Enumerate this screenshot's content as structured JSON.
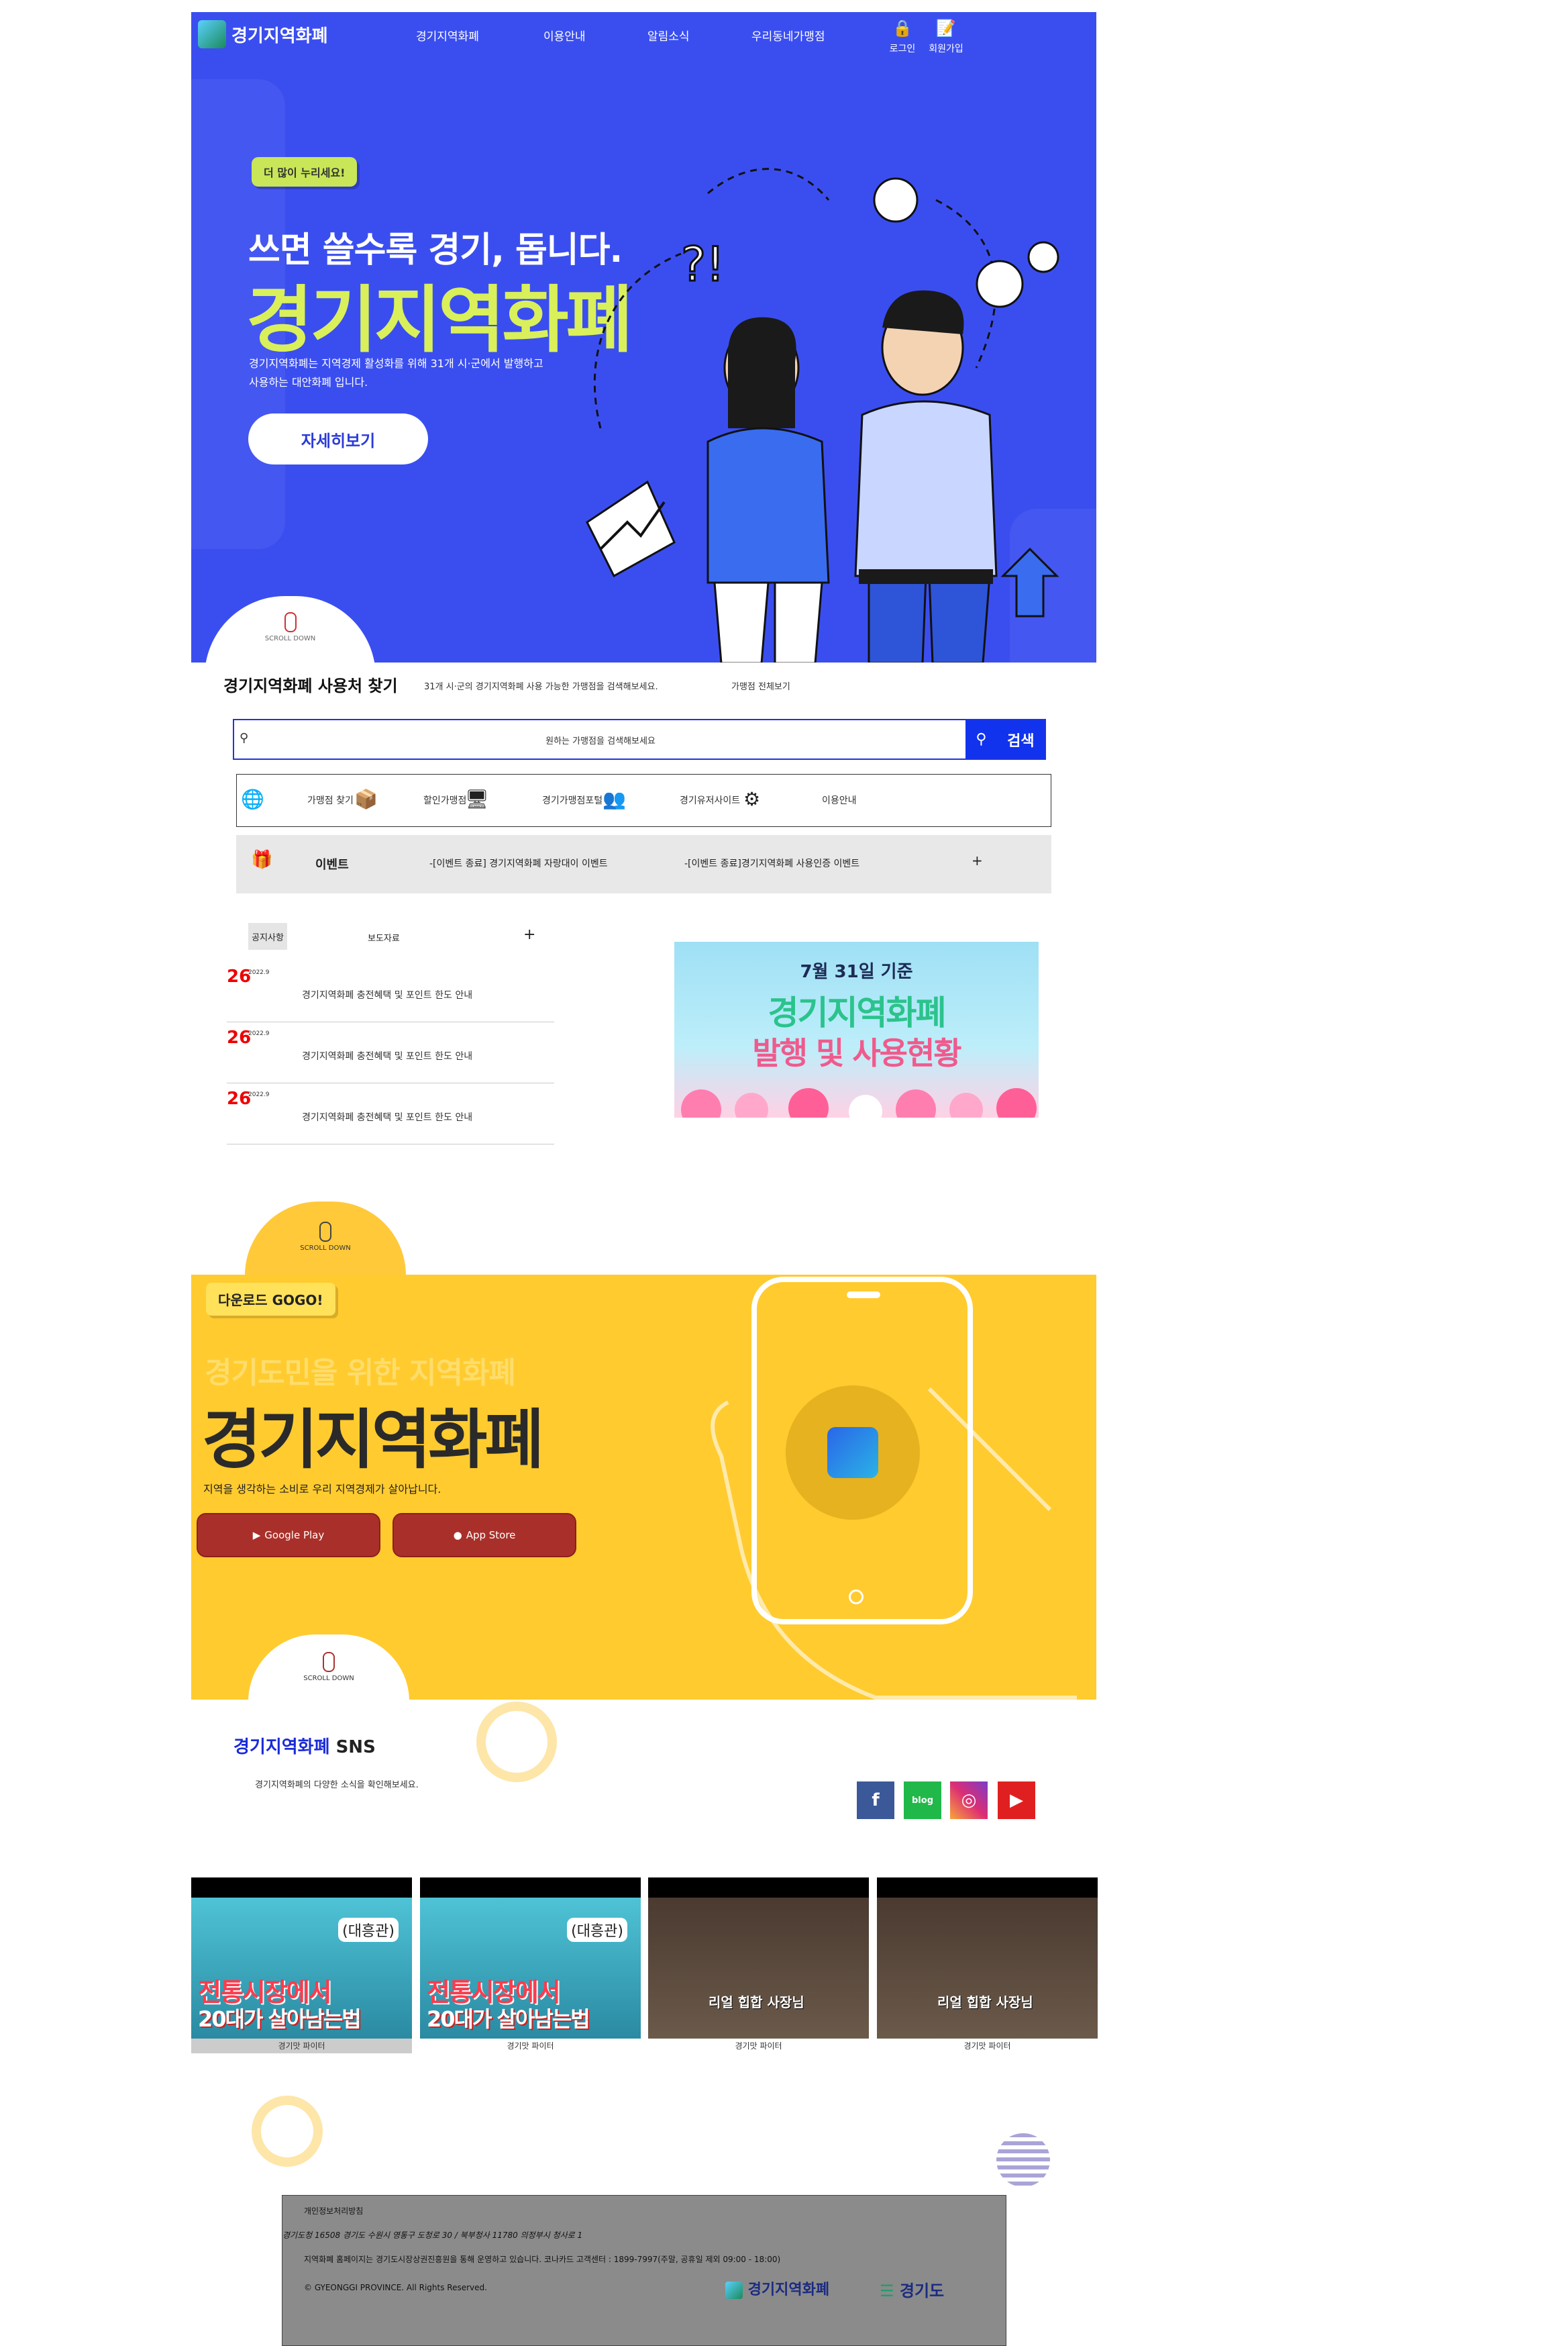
{
  "nav": {
    "logo": "경기지역화폐",
    "items": [
      "경기지역화폐",
      "이용안내",
      "알림소식",
      "우리동네가맹점"
    ],
    "login": "로그인",
    "signup": "회원가입"
  },
  "hero": {
    "bubble": "더 많이 누리세요!",
    "subtitle": "쓰면 쓸수록 경기, 돕니다.",
    "title": "경기지역화폐",
    "description": "경기지역화폐는 지역경제 활성화를 위해 31개 시·군에서 발행하고 사용하는 대안화폐 입니다.",
    "button": "자세히보기",
    "scroll": "SCROLL DOWN"
  },
  "find": {
    "title": "경기지역화폐 사용처 찾기",
    "description": "31개 시·군의 경기지역화폐 사용 가능한 가맹점을 검색해보세요.",
    "all_link": "가맹점 전체보기",
    "search_placeholder": "원하는 가맹점을 검색해보세요",
    "search_button": "검색"
  },
  "quick_menu": [
    "가맹점 찾기",
    "할인가맹점",
    "경기가맹점포털",
    "경기유저사이트",
    "이용안내"
  ],
  "event": {
    "label": "이벤트",
    "items": [
      "-[이벤트 종료] 경기지역화폐 자랑대이 이벤트",
      "-[이벤트 종료]경기지역화폐 사용인증 이벤트"
    ],
    "more": "+"
  },
  "notice_tabs": {
    "notice": "공지사항",
    "press": "보도자료",
    "more": "+"
  },
  "notices": [
    {
      "day": "26",
      "ym": "2022.9",
      "text": "경기지역화폐 충전혜택 및 포인트 한도 안내"
    },
    {
      "day": "26",
      "ym": "2022.9",
      "text": "경기지역화폐 충전혜택 및 포인트 한도 안내"
    },
    {
      "day": "26",
      "ym": "2022.9",
      "text": "경기지역화폐 충전혜택 및 포인트 한도 안내"
    }
  ],
  "banner": {
    "line1": "7월 31일 기준",
    "line2": "경기지역화폐",
    "line3": "발행 및 사용현황"
  },
  "app": {
    "bubble": "다운로드 GOGO!",
    "subtitle": "경기도민을 위한 지역화폐",
    "title": "경기지역화폐",
    "description": "지역을 생각하는 소비로 우리 지역경제가 살아납니다.",
    "google_play": "Google Play",
    "app_store": "App Store",
    "scroll": "SCROLL DOWN"
  },
  "sns": {
    "title_blue": "경기지역화폐",
    "title_black": " SNS",
    "description": "경기지역화폐의 다양한 소식을 확인해보세요.",
    "icons": [
      "facebook-icon",
      "blog-icon",
      "instagram-icon",
      "youtube-icon"
    ],
    "blog_label": "blog"
  },
  "videos": [
    {
      "headline": "전통시장에서",
      "line2": "20대가 살아남는법",
      "place": "(대흥관)",
      "caption": "경기맛 파이터"
    },
    {
      "headline": "전통시장에서",
      "line2": "20대가 살아남는법",
      "place": "(대흥관)",
      "caption": "경기맛 파이터"
    },
    {
      "headline": "리얼 힙합 사장님",
      "line2": "",
      "place": "",
      "caption": "경기맛 파이터"
    },
    {
      "headline": "리얼 힙합 사장님",
      "line2": "",
      "place": "",
      "caption": "경기맛 파이터"
    }
  ],
  "footer": {
    "privacy": "개인정보처리방침",
    "address": "경기도청 16508 경기도 수원시 영통구 도청로 30 / 북부청사 11780 의정부시 청사로 1",
    "operator": "지역화폐 홈페이지는 경기도시장상권진흥원을 통해 운영하고 있습니다.   코나카드 고객센터 : 1899-7997(주말, 공휴일 제외 09:00 - 18:00)",
    "copyright": "© GYEONGGI PROVINCE. All Rights Reserved.",
    "logo1": "경기지역화폐",
    "logo2": "경기도"
  },
  "colors": {
    "hero_bg": "#3a4ef0",
    "accent_yellow": "#ffcb2f",
    "title_green": "#d9f05a",
    "search_blue": "#1133ee"
  }
}
